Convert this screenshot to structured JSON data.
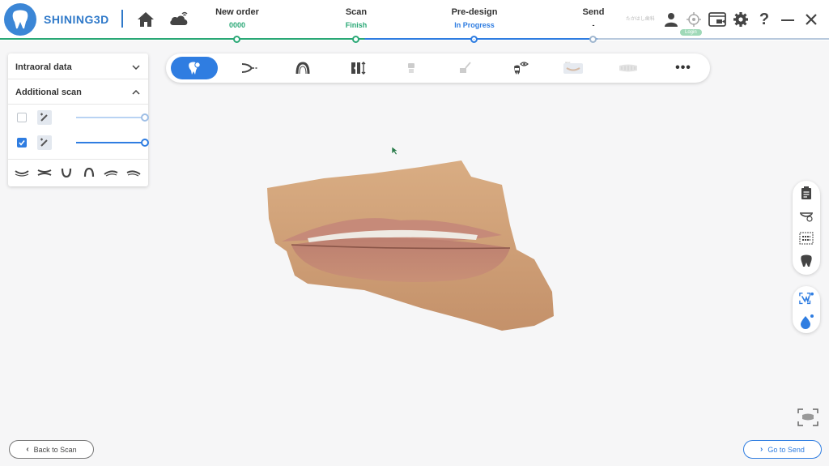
{
  "app": {
    "brand": "SHINING3D"
  },
  "header": {
    "steps": [
      {
        "label": "New order",
        "status": "0000",
        "status_color": "#2aa876"
      },
      {
        "label": "Scan",
        "status": "Finish",
        "status_color": "#2aa876"
      },
      {
        "label": "Pre-design",
        "status": "In Progress",
        "status_color": "#2f7de1"
      },
      {
        "label": "Send",
        "status": "-",
        "status_color": "#333333"
      }
    ],
    "clinic": "たかはし歯科",
    "user_badge": "Login"
  },
  "left_panel": {
    "intraoral_label": "Intraoral data",
    "additional_label": "Additional scan",
    "scans": [
      {
        "checked": false,
        "opacity": 1.0
      },
      {
        "checked": true,
        "opacity": 1.0
      }
    ]
  },
  "toolbar": {
    "tools": [
      "tooth-scan",
      "bite-align",
      "arch",
      "tooth-spacing",
      "crown",
      "brush",
      "tooth-eye",
      "smile-photo",
      "jaw-model",
      "more"
    ],
    "active": "tooth-scan"
  },
  "buttons": {
    "back_label": "Back to Scan",
    "send_label": "Go to Send"
  },
  "colors": {
    "accent": "#2f7de1",
    "success": "#2aa876",
    "brand": "#2f79c9"
  }
}
